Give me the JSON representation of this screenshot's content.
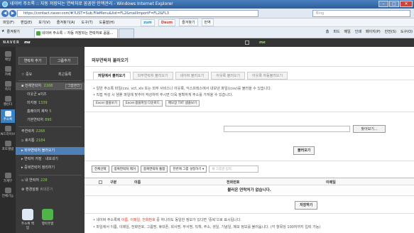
{
  "window": {
    "title": "네이버 주소록 :: 자동 저장되는 연락처로 꼼꼼한 인맥관리 - Windows Internet Explorer",
    "min": "–",
    "max": "□",
    "close": "✕"
  },
  "address": {
    "scheme": "https://",
    "url": "https://contact.naver.com/#?LIST=Sub.FileMenu&list=FL2&mailImportF=FL2&FL3",
    "search_placeholder": "Bing"
  },
  "menu": [
    "파일(F)",
    "편집(E)",
    "보기(V)",
    "즐겨찾기(A)",
    "도구(T)",
    "도움말(H)"
  ],
  "toolbar": {
    "zum": "zum",
    "daum": "Daum",
    "fav": "즐겨찾기",
    "tools": "번역"
  },
  "tabs": {
    "favorites": "즐겨찾기",
    "active": "네이버 주소록 :: 자동 저장되는 연락처로 꼼꼼...",
    "inactive": ""
  },
  "cmdbar": [
    "홈",
    "피드",
    "메일",
    "인쇄",
    "페이지(P)",
    "안전(S)",
    "도구(O)"
  ],
  "naver": {
    "logo": "NAVER",
    "me": "me",
    "me2": "me"
  },
  "iconbar": [
    {
      "label": "메일",
      "count": "99"
    },
    {
      "label": "카페",
      "count": "1"
    },
    {
      "label": "쪽지",
      "count": "5"
    },
    {
      "label": "캘린더",
      "count": ""
    },
    {
      "label": "주소록",
      "count": ""
    },
    {
      "label": "N드라이브",
      "count": ""
    },
    {
      "label": "포토앨범",
      "count": ""
    },
    {
      "label": "가계부",
      "count": ""
    },
    {
      "label": "전체기능",
      "count": ""
    }
  ],
  "sidebar": {
    "add_contact": "연락처 추가",
    "add_group": "그룹추가",
    "important": "중요",
    "recent": "최근등록",
    "all_contacts": "전체연락처",
    "all_count": "2168",
    "group_manage": "그룹관리",
    "groups": [
      {
        "name": "이웃군 a이즈",
        "count": ""
      },
      {
        "name": "미지정",
        "count": "1339"
      },
      {
        "name": "홈페이지 제작",
        "count": "5"
      },
      {
        "name": "기본연락처",
        "count": "890"
      }
    ],
    "shared": "주연락처",
    "shared_count": "2268",
    "trash": "휴지통",
    "trash_count": "2184",
    "menu": [
      "외부연락처 불러오기",
      "연락처 저장 · 내보내기",
      "중복연락처 정리하기",
      "내 연락처",
      "환경설정"
    ],
    "myinfo_count": "228",
    "settings_extra": "휴대폰기",
    "apps": [
      {
        "label": "주소록 백업"
      },
      {
        "label": "행아웃앱"
      }
    ]
  },
  "main": {
    "title": "외부연락처 불러오기",
    "tabs": [
      "파일에서 불러오기",
      "외부연락처 불러오기",
      "네이버 불러오기",
      "아웃룩 불러오기",
      "아웃룩 자동불러오기"
    ],
    "desc1": "• 일반 주소록 파일(csv, vcf, xls 또는 외부 서비스나 아웃룩, 익스프레스에서 내보낸 파일)(csv)를 불러올 수 있습니다.",
    "desc2": "• 직접 작성 시 샘플 파일에 맞추어 작성하여 주시면 더욱 정확하게 주소를 가져올 수 있습니다.",
    "sample_buttons": [
      "Excel 샘플보기",
      "Excel 샘플파일 다운로드",
      "메모장 TXT 샘플보기"
    ],
    "browse": "찾아보기...",
    "import": "불러오기",
    "actions": [
      "전체선택",
      "중복연락처 제거",
      "중복연락처 통합"
    ],
    "group_select": "한번에 그룹 설정하기",
    "new_group_placeholder": "새 그룹명 입력",
    "columns": [
      "구분",
      "이름",
      "전화번호",
      "이메일"
    ],
    "empty": "불러온 연락처가 없습니다.",
    "save": "저장하기",
    "note1_a": "• 네이버 주소록에 ",
    "note1_em": "이름, 이메일, 전화번호",
    "note1_b": " 중 하나라도 동일한 정보가 있다면 '중복'으로 표시됩니다.",
    "note2": "• 파일에서 이름, 이메일, 전화번호, 그룹명, 휴대폰, 회사명, 부서명, 직책, 주소, 생일, 기념일, 메모 정보를 불러옵니다. (각 항목당 100자까지 입력 가능)"
  }
}
